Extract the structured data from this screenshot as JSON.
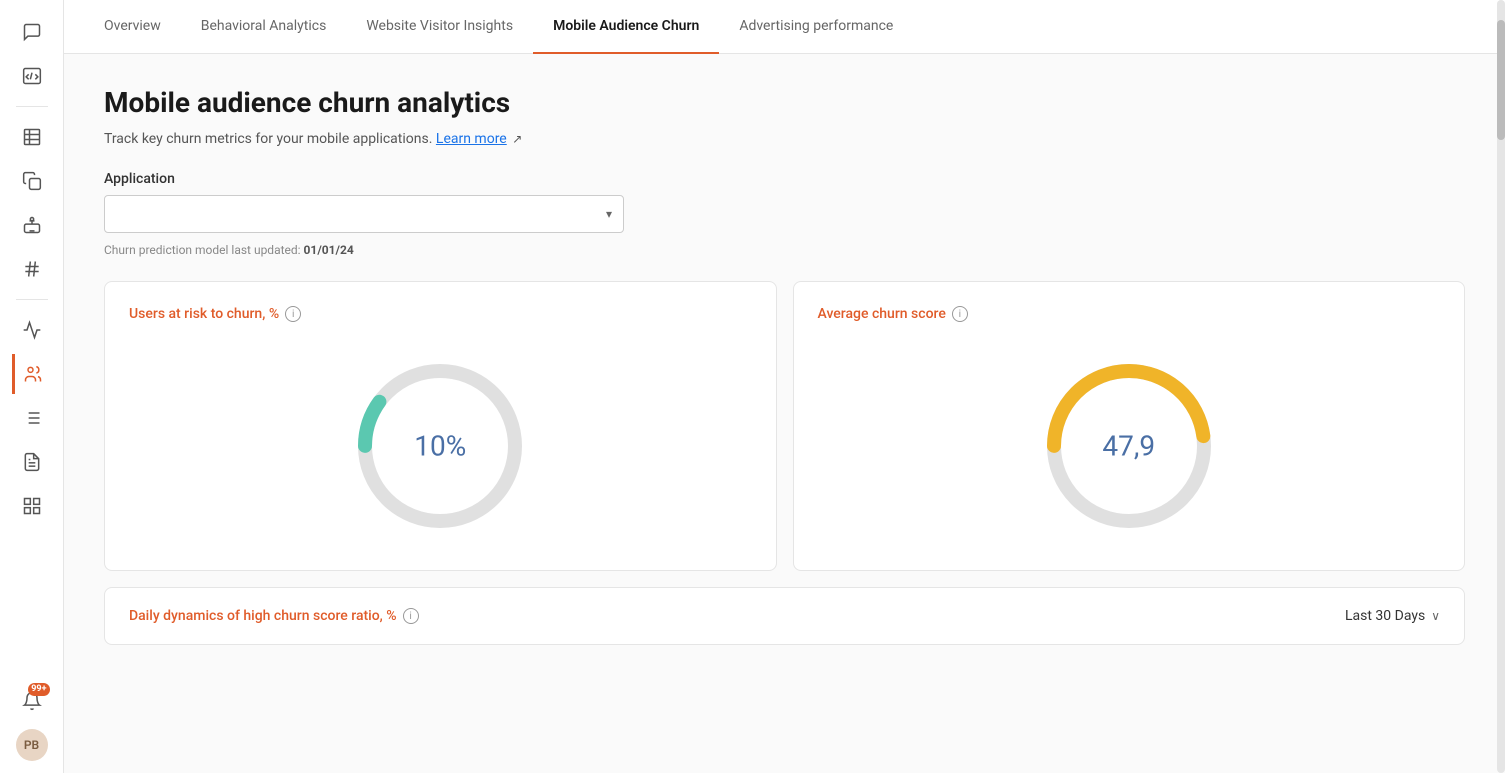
{
  "sidebar": {
    "icons": [
      {
        "name": "chat-icon",
        "symbol": "💬",
        "active": false
      },
      {
        "name": "code-icon",
        "symbol": "🖥",
        "active": false
      },
      {
        "name": "table-icon",
        "symbol": "▦",
        "active": false
      },
      {
        "name": "copy-icon",
        "symbol": "⧉",
        "active": false
      },
      {
        "name": "robot-icon",
        "symbol": "🤖",
        "active": false
      },
      {
        "name": "hash-icon",
        "symbol": "#",
        "active": false
      },
      {
        "name": "analytics-icon",
        "symbol": "📈",
        "active": false
      },
      {
        "name": "audience-icon",
        "symbol": "👥",
        "active": true
      },
      {
        "name": "list-icon",
        "symbol": "☰",
        "active": false
      },
      {
        "name": "report-icon",
        "symbol": "📋",
        "active": false
      },
      {
        "name": "grid-icon",
        "symbol": "⊞",
        "active": false
      }
    ],
    "notification_badge": "99+",
    "avatar_initials": "PB"
  },
  "nav": {
    "tabs": [
      {
        "id": "overview",
        "label": "Overview",
        "active": false
      },
      {
        "id": "behavioral",
        "label": "Behavioral Analytics",
        "active": false
      },
      {
        "id": "visitor",
        "label": "Website Visitor Insights",
        "active": false
      },
      {
        "id": "mobile",
        "label": "Mobile Audience Churn",
        "active": true
      },
      {
        "id": "advertising",
        "label": "Advertising performance",
        "active": false
      }
    ]
  },
  "page": {
    "title": "Mobile audience churn analytics",
    "subtitle": "Track key churn metrics for your mobile applications.",
    "learn_more_label": "Learn more",
    "application_label": "Application",
    "select_placeholder": "                                        ",
    "update_info_prefix": "Churn prediction model last updated: ",
    "update_info_date": "01/01/24"
  },
  "cards": [
    {
      "id": "users-at-risk",
      "title": "Users at risk to churn, %",
      "value": "10%",
      "donut_color": "#5bc8b0",
      "donut_bg": "#e0e0e0",
      "percentage": 10
    },
    {
      "id": "avg-churn-score",
      "title": "Average churn score",
      "value": "47,9",
      "donut_color": "#f0b429",
      "donut_bg": "#e0e0e0",
      "percentage": 47.9
    }
  ],
  "bottom_section": {
    "title": "Daily dynamics of high churn score ratio, %",
    "date_filter_label": "Last 30 Days",
    "date_filter_arrow": "∨"
  }
}
